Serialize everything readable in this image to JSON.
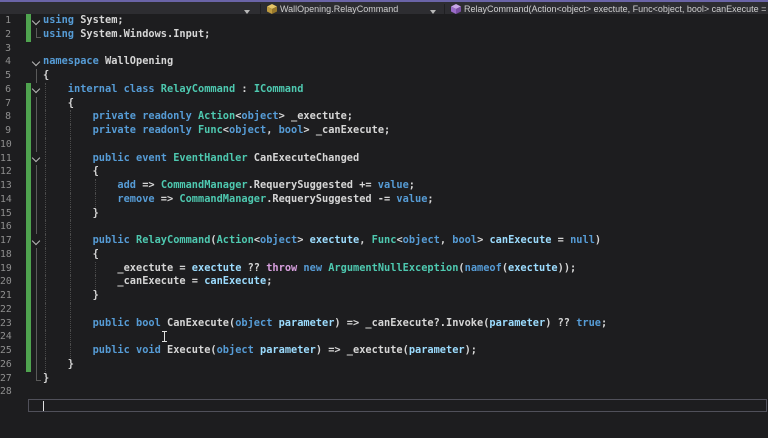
{
  "colors": {
    "bg": "#1d1d1f",
    "navbar_bg": "#2d2d31",
    "accent_purple": "#6a64a7",
    "divider": "#1f1f22",
    "navbar_text": "#cfcfcf",
    "line_number": "#8f8f8f",
    "keyword": "#569cd6",
    "control": "#d8a0df",
    "type": "#4ec9b0",
    "param": "#9cdcfe",
    "plain": "#d6d6d6",
    "change_bar": "#4fa34f",
    "guide": "#4a4a4a",
    "outline": "#5a5a5a",
    "chevron": "#b8b8b8",
    "caret": "#e0e0e0",
    "current_line_border": "#50505a",
    "class_icon_top": "#e6c567",
    "class_icon_left": "#be9b3f",
    "class_icon_right": "#98782b",
    "method_icon_top": "#c9a6e8",
    "method_icon_left": "#9a6bc9",
    "method_icon_right": "#7b50a5"
  },
  "navbar": {
    "project_label": "",
    "type_label": "WallOpening.RelayCommand",
    "member_label": "RelayCommand(Action<object> exectute, Func<object, bool> canExecute ="
  },
  "editor": {
    "lines": [
      {
        "n": 1,
        "bar": true,
        "o": "chev",
        "g": [],
        "t": [
          [
            "k",
            "using"
          ],
          [
            "p",
            " System;"
          ]
        ]
      },
      {
        "n": 2,
        "bar": true,
        "o": "end",
        "g": [],
        "t": [
          [
            "k",
            "using"
          ],
          [
            "p",
            " System.Windows.Input;"
          ]
        ]
      },
      {
        "n": 3,
        "bar": false,
        "o": "",
        "g": [],
        "t": []
      },
      {
        "n": 4,
        "bar": false,
        "o": "chev",
        "g": [],
        "t": [
          [
            "k",
            "namespace"
          ],
          [
            "p",
            " WallOpening"
          ]
        ]
      },
      {
        "n": 5,
        "bar": false,
        "o": "line",
        "g": [],
        "t": [
          [
            "p",
            "{"
          ]
        ]
      },
      {
        "n": 6,
        "bar": true,
        "o": "chev",
        "g": [
          0
        ],
        "t": [
          [
            "k",
            "    internal class "
          ],
          [
            "t",
            "RelayCommand"
          ],
          [
            "p",
            " : "
          ],
          [
            "t",
            "ICommand"
          ]
        ]
      },
      {
        "n": 7,
        "bar": true,
        "o": "line",
        "g": [
          0
        ],
        "t": [
          [
            "p",
            "    {"
          ]
        ]
      },
      {
        "n": 8,
        "bar": true,
        "o": "line",
        "g": [
          0,
          1
        ],
        "t": [
          [
            "k",
            "        private readonly "
          ],
          [
            "t",
            "Action"
          ],
          [
            "p",
            "<"
          ],
          [
            "k",
            "object"
          ],
          [
            "p",
            "> _exectute;"
          ]
        ]
      },
      {
        "n": 9,
        "bar": true,
        "o": "line",
        "g": [
          0,
          1
        ],
        "t": [
          [
            "k",
            "        private readonly "
          ],
          [
            "t",
            "Func"
          ],
          [
            "p",
            "<"
          ],
          [
            "k",
            "object"
          ],
          [
            "p",
            ", "
          ],
          [
            "k",
            "bool"
          ],
          [
            "p",
            "> _canExecute;"
          ]
        ]
      },
      {
        "n": 10,
        "bar": true,
        "o": "line",
        "g": [
          0,
          1
        ],
        "t": []
      },
      {
        "n": 11,
        "bar": true,
        "o": "chev",
        "g": [
          0,
          1
        ],
        "t": [
          [
            "k",
            "        public event "
          ],
          [
            "t",
            "EventHandler"
          ],
          [
            "p",
            " CanExecuteChanged"
          ]
        ]
      },
      {
        "n": 12,
        "bar": true,
        "o": "line",
        "g": [
          0,
          1
        ],
        "t": [
          [
            "p",
            "        {"
          ]
        ]
      },
      {
        "n": 13,
        "bar": true,
        "o": "line",
        "g": [
          0,
          1,
          2
        ],
        "t": [
          [
            "k",
            "            add"
          ],
          [
            "p",
            " => "
          ],
          [
            "t",
            "CommandManager"
          ],
          [
            "p",
            ".RequerySuggested += "
          ],
          [
            "k",
            "value"
          ],
          [
            "p",
            ";"
          ]
        ]
      },
      {
        "n": 14,
        "bar": true,
        "o": "line",
        "g": [
          0,
          1,
          2
        ],
        "t": [
          [
            "k",
            "            remove"
          ],
          [
            "p",
            " => "
          ],
          [
            "t",
            "CommandManager"
          ],
          [
            "p",
            ".RequerySuggested -= "
          ],
          [
            "k",
            "value"
          ],
          [
            "p",
            ";"
          ]
        ]
      },
      {
        "n": 15,
        "bar": true,
        "o": "line",
        "g": [
          0,
          1
        ],
        "t": [
          [
            "p",
            "        }"
          ]
        ]
      },
      {
        "n": 16,
        "bar": true,
        "o": "line",
        "g": [
          0,
          1
        ],
        "t": []
      },
      {
        "n": 17,
        "bar": true,
        "o": "chev",
        "g": [
          0,
          1
        ],
        "t": [
          [
            "k",
            "        public "
          ],
          [
            "t",
            "RelayCommand"
          ],
          [
            "p",
            "("
          ],
          [
            "t",
            "Action"
          ],
          [
            "p",
            "<"
          ],
          [
            "k",
            "object"
          ],
          [
            "p",
            "> "
          ],
          [
            "v",
            "exectute"
          ],
          [
            "p",
            ", "
          ],
          [
            "t",
            "Func"
          ],
          [
            "p",
            "<"
          ],
          [
            "k",
            "object"
          ],
          [
            "p",
            ", "
          ],
          [
            "k",
            "bool"
          ],
          [
            "p",
            "> "
          ],
          [
            "v",
            "canExecute"
          ],
          [
            "p",
            " = "
          ],
          [
            "k",
            "null"
          ],
          [
            "p",
            ")"
          ]
        ]
      },
      {
        "n": 18,
        "bar": true,
        "o": "line",
        "g": [
          0,
          1
        ],
        "t": [
          [
            "p",
            "        {"
          ]
        ]
      },
      {
        "n": 19,
        "bar": true,
        "o": "line",
        "g": [
          0,
          1,
          2
        ],
        "t": [
          [
            "p",
            "            _exectute = "
          ],
          [
            "v",
            "exectute"
          ],
          [
            "p",
            " ?? "
          ],
          [
            "c",
            "throw"
          ],
          [
            "p",
            " "
          ],
          [
            "k",
            "new"
          ],
          [
            "p",
            " "
          ],
          [
            "t",
            "ArgumentNullException"
          ],
          [
            "p",
            "("
          ],
          [
            "k",
            "nameof"
          ],
          [
            "p",
            "("
          ],
          [
            "v",
            "exectute"
          ],
          [
            "p",
            "));"
          ]
        ]
      },
      {
        "n": 20,
        "bar": true,
        "o": "line",
        "g": [
          0,
          1,
          2
        ],
        "t": [
          [
            "p",
            "            _canExecute = "
          ],
          [
            "v",
            "canExecute"
          ],
          [
            "p",
            ";"
          ]
        ]
      },
      {
        "n": 21,
        "bar": true,
        "o": "line",
        "g": [
          0,
          1
        ],
        "t": [
          [
            "p",
            "        }"
          ]
        ]
      },
      {
        "n": 22,
        "bar": true,
        "o": "line",
        "g": [
          0,
          1
        ],
        "t": []
      },
      {
        "n": 23,
        "bar": true,
        "o": "line",
        "g": [
          0,
          1
        ],
        "t": [
          [
            "k",
            "        public bool "
          ],
          [
            "p",
            "CanExecute("
          ],
          [
            "k",
            "object"
          ],
          [
            "p",
            " "
          ],
          [
            "v",
            "parameter"
          ],
          [
            "p",
            ") => _canExecute?.Invoke("
          ],
          [
            "v",
            "parameter"
          ],
          [
            "p",
            ") ?? "
          ],
          [
            "k",
            "true"
          ],
          [
            "p",
            ";"
          ]
        ]
      },
      {
        "n": 24,
        "bar": true,
        "o": "line",
        "g": [
          0,
          1
        ],
        "t": []
      },
      {
        "n": 25,
        "bar": true,
        "o": "line",
        "g": [
          0,
          1
        ],
        "t": [
          [
            "k",
            "        public void "
          ],
          [
            "p",
            "Execute("
          ],
          [
            "k",
            "object"
          ],
          [
            "p",
            " "
          ],
          [
            "v",
            "parameter"
          ],
          [
            "p",
            ") => _exectute("
          ],
          [
            "v",
            "parameter"
          ],
          [
            "p",
            ");"
          ]
        ]
      },
      {
        "n": 26,
        "bar": true,
        "o": "line",
        "g": [
          0
        ],
        "t": [
          [
            "p",
            "    }"
          ]
        ]
      },
      {
        "n": 27,
        "bar": false,
        "o": "end",
        "g": [],
        "t": [
          [
            "p",
            "}"
          ]
        ]
      },
      {
        "n": 28,
        "bar": false,
        "o": "",
        "g": [],
        "t": []
      }
    ]
  }
}
